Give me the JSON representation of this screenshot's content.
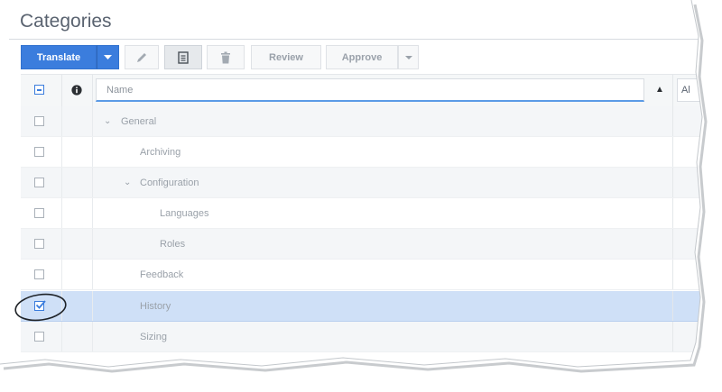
{
  "page": {
    "title": "Categories"
  },
  "toolbar": {
    "translate_label": "Translate",
    "review_label": "Review",
    "approve_label": "Approve",
    "colors": {
      "primary": "#3b7ddd",
      "disabled_text": "#9aa1aa"
    }
  },
  "grid": {
    "header": {
      "name_placeholder": "Name",
      "sort_indicator": "▲",
      "clipped_column_text": "Al"
    },
    "rows": [
      {
        "label": "General",
        "expandable": true,
        "expanded": true,
        "checked": false,
        "level": 0
      },
      {
        "label": "Archiving",
        "expandable": false,
        "checked": false,
        "level": 1
      },
      {
        "label": "Configuration",
        "expandable": true,
        "expanded": true,
        "checked": false,
        "level": 1
      },
      {
        "label": "Languages",
        "expandable": false,
        "checked": false,
        "level": 2
      },
      {
        "label": "Roles",
        "expandable": false,
        "checked": false,
        "level": 2
      },
      {
        "label": "Feedback",
        "expandable": false,
        "checked": false,
        "level": 1
      },
      {
        "label": "History",
        "expandable": false,
        "checked": true,
        "selected": true,
        "level": 1
      },
      {
        "label": "Sizing",
        "expandable": false,
        "checked": false,
        "level": 1
      }
    ],
    "colors": {
      "selected_row": "#cfe0f7",
      "zebra": "#f4f6f8",
      "input_focus": "#5b9be6"
    }
  }
}
